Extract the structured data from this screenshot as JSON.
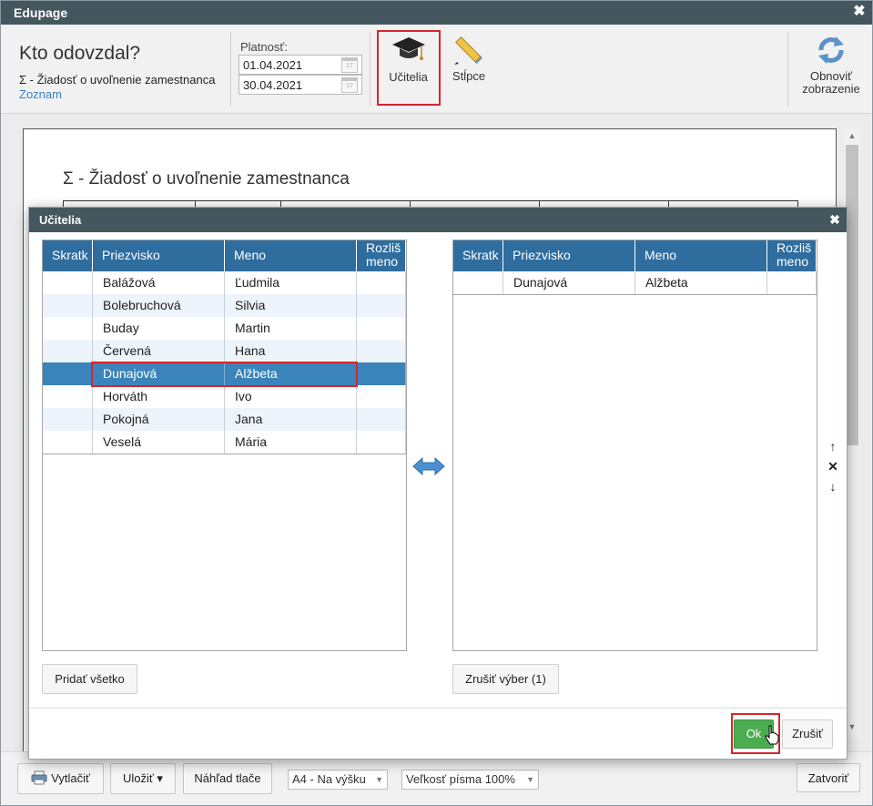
{
  "window": {
    "title": "Edupage"
  },
  "toolbar": {
    "title": "Kto odovzdal?",
    "subtitle": "Σ - Žiadosť o uvoľnenie zamestnanca",
    "link": "Zoznam",
    "validity_label": "Platnosť:",
    "date_from": "01.04.2021",
    "date_to": "30.04.2021",
    "teachers_button": "Učitelia",
    "columns_button": "Stĺpce",
    "refresh_button_line1": "Obnoviť",
    "refresh_button_line2": "zobrazenie"
  },
  "document": {
    "heading": "Σ - Žiadosť o uvoľnenie zamestnanca"
  },
  "dialog": {
    "title": "Učitelia",
    "left_grid": {
      "columns": [
        "Skratk",
        "Priezvisko",
        "Meno",
        "Rozliš",
        "meno"
      ],
      "rows": [
        {
          "abbr": "",
          "surname": "Balážová",
          "name": "Ľudmila",
          "distinct": ""
        },
        {
          "abbr": "",
          "surname": "Bolebruchová",
          "name": "Silvia",
          "distinct": ""
        },
        {
          "abbr": "",
          "surname": "Buday",
          "name": "Martin",
          "distinct": ""
        },
        {
          "abbr": "",
          "surname": "Červená",
          "name": "Hana",
          "distinct": ""
        },
        {
          "abbr": "",
          "surname": "Dunajová",
          "name": "Alžbeta",
          "distinct": ""
        },
        {
          "abbr": "",
          "surname": "Horváth",
          "name": "Ivo",
          "distinct": ""
        },
        {
          "abbr": "",
          "surname": "Pokojná",
          "name": "Jana",
          "distinct": ""
        },
        {
          "abbr": "",
          "surname": "Veselá",
          "name": "Mária",
          "distinct": ""
        }
      ],
      "selected_row": "Dunajová"
    },
    "right_grid": {
      "columns": [
        "Skratk",
        "Priezvisko",
        "Meno",
        "Rozliš",
        "meno"
      ],
      "rows": [
        {
          "abbr": "",
          "surname": "Dunajová",
          "name": "Alžbeta",
          "distinct": ""
        }
      ]
    },
    "add_all_button": "Pridať všetko",
    "clear_selection_button": "Zrušiť výber (1)",
    "ok_button": "Ok",
    "cancel_button": "Zrušiť",
    "move_up_icon": "arrow-up-icon",
    "remove_icon": "close-icon",
    "move_down_icon": "arrow-down-icon",
    "transfer_icon": "double-arrow-icon"
  },
  "bottombar": {
    "print_button": "Vytlačiť",
    "save_button": "Uložiť ▾",
    "preview_button": "Náhľad tlače",
    "paper_select": "A4 - Na výšku",
    "font_select": "Veľkosť písma 100%",
    "close_button": "Zatvoriť"
  },
  "colors": {
    "header_bg": "#44575f",
    "grid_header": "#2f6d9f",
    "selected_row": "#3a84bb",
    "ok_green": "#4cad50",
    "highlight_red": "#d9242b",
    "link_blue": "#3b7fc4"
  }
}
